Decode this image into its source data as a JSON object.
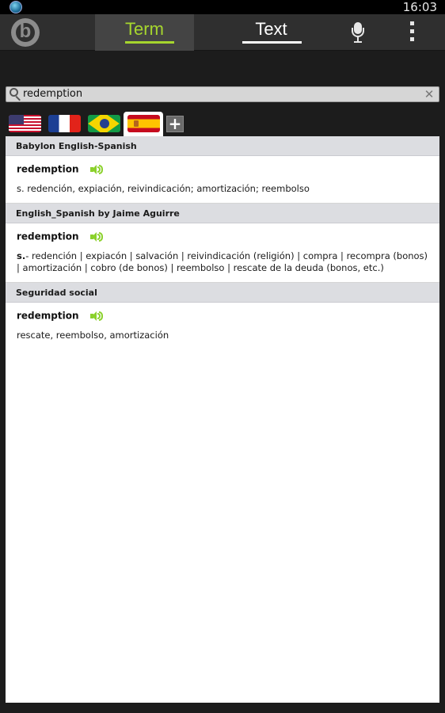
{
  "status_bar": {
    "time": "16:03"
  },
  "header": {
    "tabs": [
      {
        "label": "Term",
        "active": true
      },
      {
        "label": "Text",
        "active": false
      }
    ],
    "icons": [
      "babylon-logo-icon",
      "microphone-icon",
      "overflow-menu-icon"
    ]
  },
  "search": {
    "value": "redemption",
    "icons": [
      "search-icon",
      "clear-icon"
    ]
  },
  "languages": {
    "flags": [
      "us-flag",
      "france-flag",
      "brazil-flag",
      "spain-flag"
    ],
    "selected": "spain-flag",
    "add_label": "+"
  },
  "results": [
    {
      "dictionary": "Babylon English-Spanish",
      "term": "redemption",
      "definition_prefix": "",
      "definition": "s. redención, expiación, reivindicación; amortización; reembolso"
    },
    {
      "dictionary": "English_Spanish by Jaime Aguirre",
      "term": "redemption",
      "definition_prefix": "s.",
      "definition": "- redención | expiacón | salvación | reivindicación (religión) | compra | recompra (bonos) | amortización | cobro (de bonos) | reembolso | rescate de la deuda (bonos, etc.)"
    },
    {
      "dictionary": "Seguridad social",
      "term": "redemption",
      "definition_prefix": "",
      "definition": "rescate, reembolso, amortización"
    }
  ],
  "colors": {
    "accent": "#a6d62e",
    "speaker": "#8bd12c",
    "action_bar": "#2f2f2f",
    "background": "#1c1c1c",
    "header_row": "#dcdde1"
  }
}
